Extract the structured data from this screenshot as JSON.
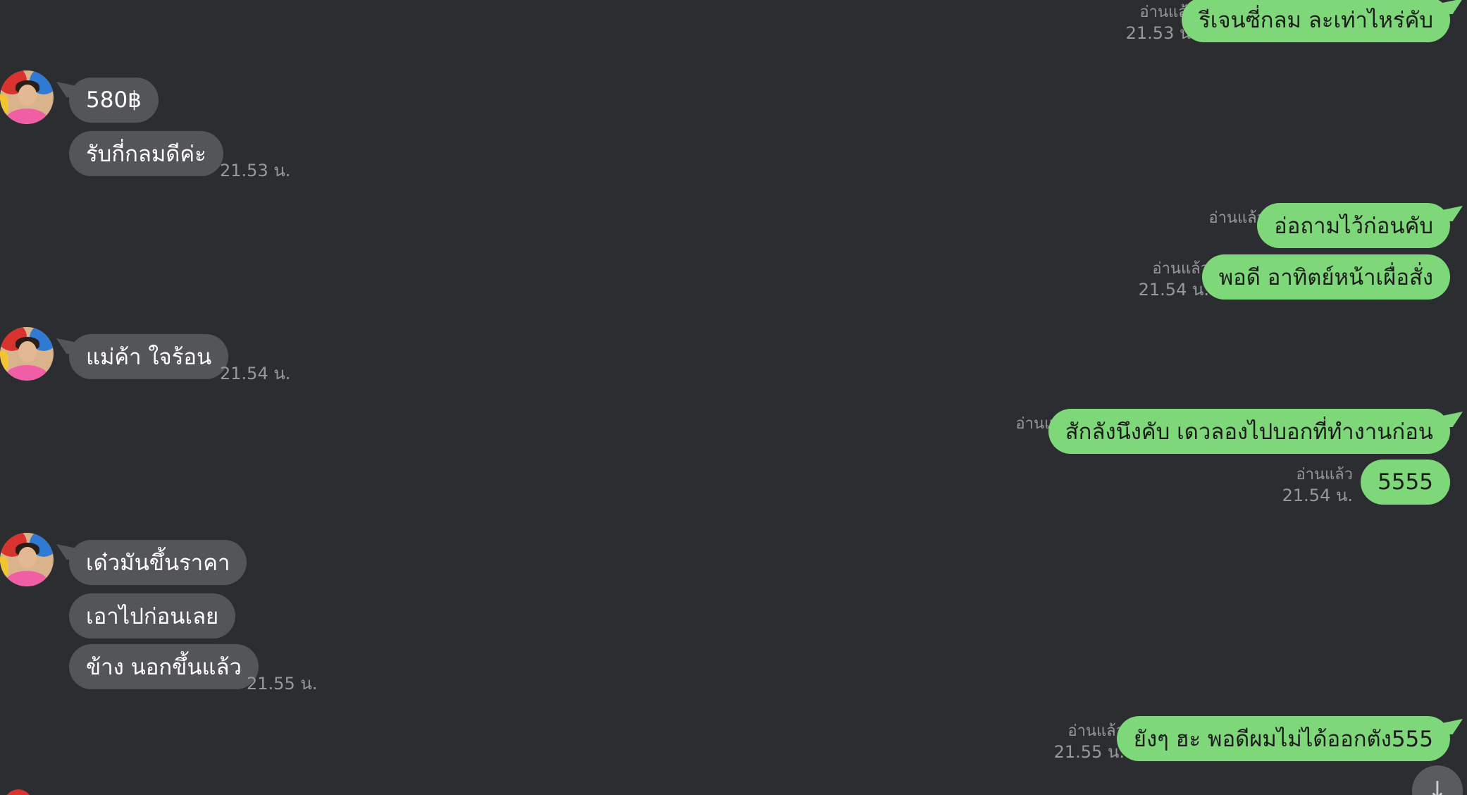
{
  "read_label": "อ่านแล้ว",
  "messages": {
    "m1": {
      "text": "รีเจนซี่กลม ละเท่าไหร่คับ",
      "time": "21.53 น."
    },
    "m2": {
      "text": "580฿"
    },
    "m3": {
      "text": "รับกี่กลมดีค่ะ",
      "time": "21.53 น."
    },
    "m4": {
      "text": "อ่อถามไว้ก่อนคับ"
    },
    "m5": {
      "text": "พอดี อาทิตย์หน้าเผื่อสั่ง",
      "time": "21.54 น."
    },
    "m6": {
      "text": "แม่ค้า ใจร้อน",
      "time": "21.54 น."
    },
    "m7": {
      "text": "สักลังนึงคับ เดวลองไปบอกที่ทำงานก่อน"
    },
    "m8": {
      "text": "5555",
      "time": "21.54 น."
    },
    "m9": {
      "text": "เด๋วมันขึ้นราคา"
    },
    "m10": {
      "text": "เอาไปก่อนเลย"
    },
    "m11": {
      "text": "ข้าง นอกขึ้นแล้ว",
      "time": "21.55 น."
    },
    "m12": {
      "text": "ยังๆ ฮะ พอดีผมไม่ได้ออกตัง555",
      "time": "21.55 น."
    }
  },
  "scroll_button_icon": "↓",
  "colors": {
    "background": "#2c2d30",
    "incoming_bubble": "#545558",
    "outgoing_bubble": "#7ed87a",
    "meta_text": "#97989b"
  },
  "icons": {
    "avatar": "contact-avatar",
    "scroll": "arrow-down-icon"
  }
}
